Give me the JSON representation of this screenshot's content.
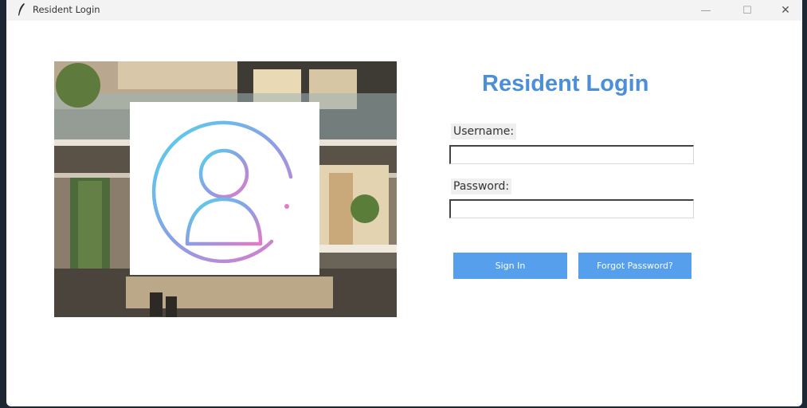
{
  "window": {
    "title": "Resident Login",
    "minimize_label": "—",
    "maximize_label": "☐",
    "close_label": "✕"
  },
  "form": {
    "heading": "Resident Login",
    "username_label": "Username:",
    "username_value": "",
    "password_label": "Password:",
    "password_value": "",
    "signin_label": "Sign In",
    "forgot_label": "Forgot Password?"
  },
  "colors": {
    "accent": "#4a8fd8",
    "button": "#559fec"
  },
  "icons": {
    "app": "feather-icon",
    "logo": "user-profile-icon"
  }
}
